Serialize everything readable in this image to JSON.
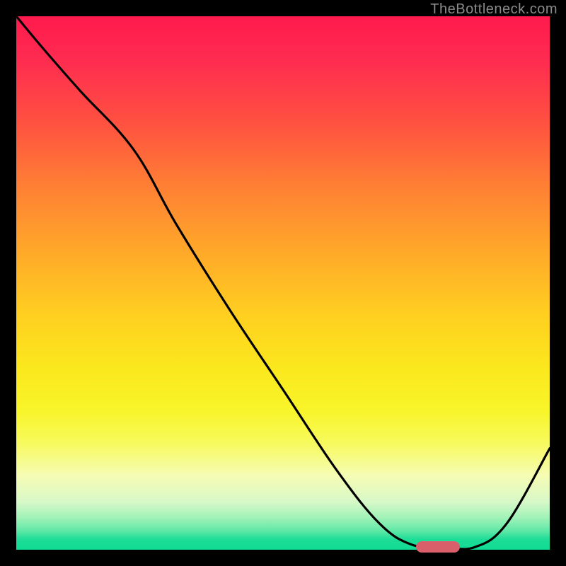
{
  "watermark": "TheBottleneck.com",
  "chart_data": {
    "type": "line",
    "title": "",
    "xlabel": "",
    "ylabel": "",
    "xlim": [
      0,
      100
    ],
    "ylim": [
      0,
      100
    ],
    "grid": false,
    "legend": false,
    "series": [
      {
        "name": "curve",
        "x": [
          0,
          5,
          12,
          22,
          30,
          40,
          50,
          60,
          68,
          74,
          80,
          86,
          92,
          100
        ],
        "y": [
          100,
          94,
          86,
          75,
          61,
          45,
          30,
          15,
          5,
          1,
          0.5,
          0.5,
          5,
          19
        ]
      }
    ],
    "marker": {
      "x": 79,
      "y": 0.5,
      "color": "#d9606a"
    },
    "background_gradient": {
      "top": "#ff1a4d",
      "mid_upper": "#ffa829",
      "mid_lower": "#f8f52a",
      "bottom": "#0fdb94"
    }
  }
}
